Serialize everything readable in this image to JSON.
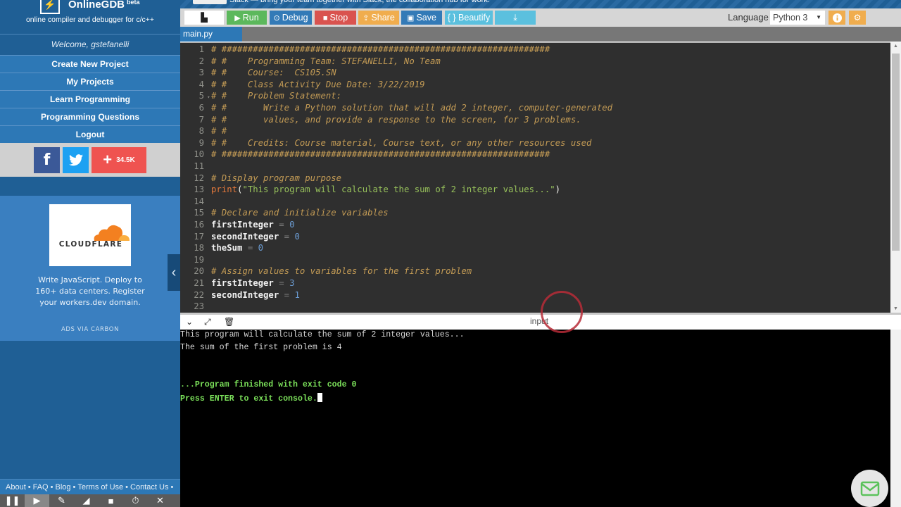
{
  "app": {
    "brand": "OnlineGDB",
    "brand_sup": "beta",
    "tagline": "online compiler and debugger for c/c++",
    "welcome": "Welcome, gstefanelli"
  },
  "sidebar": {
    "nav": [
      {
        "label": "Create New Project"
      },
      {
        "label": "My Projects"
      },
      {
        "label": "Learn Programming"
      },
      {
        "label": "Programming Questions"
      },
      {
        "label": "Logout"
      }
    ],
    "social": {
      "facebook_icon": "f",
      "twitter_icon": "🐦",
      "share_count": "34.5K"
    },
    "ad": {
      "brand": "CLOUDFLARE",
      "text": "Write JavaScript. Deploy to 160+ data centers. Register your workers.dev domain.",
      "via": "ADS VIA CARBON"
    },
    "footer_links": [
      {
        "label": "About"
      },
      {
        "label": "FAQ"
      },
      {
        "label": "Blog"
      },
      {
        "label": "Terms of Use"
      },
      {
        "label": "Contact Us"
      }
    ],
    "footer_sep": "•",
    "collapse_icon": "‹"
  },
  "banner": {
    "text": "Slack — bring your team together with Slack, the collaboration hub for work."
  },
  "toolbar": {
    "buttons": [
      {
        "label": "Run",
        "icon": "▶",
        "color": "#5cb85c"
      },
      {
        "label": "Debug",
        "icon": "⊙",
        "color": "#337ab7"
      },
      {
        "label": "Stop",
        "icon": "■",
        "color": "#d9534f"
      },
      {
        "label": "Share",
        "icon": "⇪",
        "color": "#f0ad4e"
      },
      {
        "label": "Save",
        "icon": "💾",
        "color": "#337ab7"
      },
      {
        "label": "{ } Beautify",
        "icon": "",
        "color": "#5bc0de"
      },
      {
        "label": "",
        "icon": "⤓",
        "color": "#5bc0de"
      }
    ],
    "language_label": "Language",
    "language_value": "Python 3",
    "info_icon": "i",
    "settings_icon": "⚙"
  },
  "file_tab": "main.py",
  "editor": {
    "lines": [
      {
        "n": 1,
        "fold": false,
        "parts": [
          {
            "t": "# ###############################################################",
            "c": "cmt"
          }
        ]
      },
      {
        "n": 2,
        "fold": false,
        "parts": [
          {
            "t": "# #    Programming Team: STEFANELLI, No Team",
            "c": "cmt"
          }
        ]
      },
      {
        "n": 3,
        "fold": false,
        "parts": [
          {
            "t": "# #    Course:  CS105.SN",
            "c": "cmt"
          }
        ]
      },
      {
        "n": 4,
        "fold": false,
        "parts": [
          {
            "t": "# #    Class Activity Due Date: 3/22/2019",
            "c": "cmt"
          }
        ]
      },
      {
        "n": 5,
        "fold": true,
        "parts": [
          {
            "t": "# #    Problem Statement:",
            "c": "cmt"
          }
        ]
      },
      {
        "n": 6,
        "fold": false,
        "parts": [
          {
            "t": "# #       Write a Python solution that will add 2 integer, computer-generated",
            "c": "cmt"
          }
        ]
      },
      {
        "n": 7,
        "fold": false,
        "parts": [
          {
            "t": "# #       values, and provide a response to the screen, for 3 problems.",
            "c": "cmt"
          }
        ]
      },
      {
        "n": 8,
        "fold": false,
        "parts": [
          {
            "t": "# #",
            "c": "cmt"
          }
        ]
      },
      {
        "n": 9,
        "fold": false,
        "parts": [
          {
            "t": "# #    Credits: Course material, Course text, or any other resources used",
            "c": "cmt"
          }
        ]
      },
      {
        "n": 10,
        "fold": false,
        "parts": [
          {
            "t": "# ###############################################################",
            "c": "cmt"
          }
        ]
      },
      {
        "n": 11,
        "fold": false,
        "parts": []
      },
      {
        "n": 12,
        "fold": false,
        "parts": [
          {
            "t": "# Display program purpose",
            "c": "cmt"
          }
        ]
      },
      {
        "n": 13,
        "fold": false,
        "parts": [
          {
            "t": "print",
            "c": "kw"
          },
          {
            "t": "(",
            "c": "code"
          },
          {
            "t": "\"This program will calculate the sum of 2 integer values...\"",
            "c": "str"
          },
          {
            "t": ")",
            "c": "code"
          }
        ]
      },
      {
        "n": 14,
        "fold": false,
        "parts": []
      },
      {
        "n": 15,
        "fold": false,
        "parts": [
          {
            "t": "# Declare and initialize variables",
            "c": "cmt"
          }
        ]
      },
      {
        "n": 16,
        "fold": false,
        "parts": [
          {
            "t": "firstInteger",
            "c": "id"
          },
          {
            "t": " = ",
            "c": "op"
          },
          {
            "t": "0",
            "c": "num"
          }
        ]
      },
      {
        "n": 17,
        "fold": false,
        "parts": [
          {
            "t": "secondInteger",
            "c": "id"
          },
          {
            "t": " = ",
            "c": "op"
          },
          {
            "t": "0",
            "c": "num"
          }
        ]
      },
      {
        "n": 18,
        "fold": false,
        "parts": [
          {
            "t": "theSum",
            "c": "id"
          },
          {
            "t": " = ",
            "c": "op"
          },
          {
            "t": "0",
            "c": "num"
          }
        ]
      },
      {
        "n": 19,
        "fold": false,
        "parts": []
      },
      {
        "n": 20,
        "fold": false,
        "parts": [
          {
            "t": "# Assign values to variables for the first problem",
            "c": "cmt"
          }
        ]
      },
      {
        "n": 21,
        "fold": false,
        "parts": [
          {
            "t": "firstInteger",
            "c": "id"
          },
          {
            "t": " = ",
            "c": "op"
          },
          {
            "t": "3",
            "c": "num"
          }
        ]
      },
      {
        "n": 22,
        "fold": false,
        "parts": [
          {
            "t": "secondInteger",
            "c": "id"
          },
          {
            "t": " = ",
            "c": "op"
          },
          {
            "t": "1",
            "c": "num"
          }
        ]
      },
      {
        "n": 23,
        "fold": false,
        "parts": []
      }
    ]
  },
  "console": {
    "input_label": "input",
    "lines": [
      {
        "text": "This program will calculate the sum of 2 integer values...",
        "green": false
      },
      {
        "text": "The sum of the first problem is 4",
        "green": false
      },
      {
        "text": "",
        "green": false
      },
      {
        "text": "",
        "green": false
      },
      {
        "text": "...Program finished with exit code 0",
        "green": true
      },
      {
        "text": "Press ENTER to exit console.",
        "green": true,
        "cursor": true
      }
    ]
  },
  "player_bar": {
    "icons": [
      "pause-icon",
      "play-icon",
      "pen-icon",
      "highlighter-icon",
      "camera-icon",
      "timer-icon",
      "close-icon"
    ]
  },
  "colors": {
    "sidebar": "#1f5f95",
    "nav": "#2d78b6",
    "editor_bg": "#2f2f2f",
    "console_bg": "#000000",
    "console_green": "#7be05a",
    "accent_orange": "#f0ad4e"
  }
}
